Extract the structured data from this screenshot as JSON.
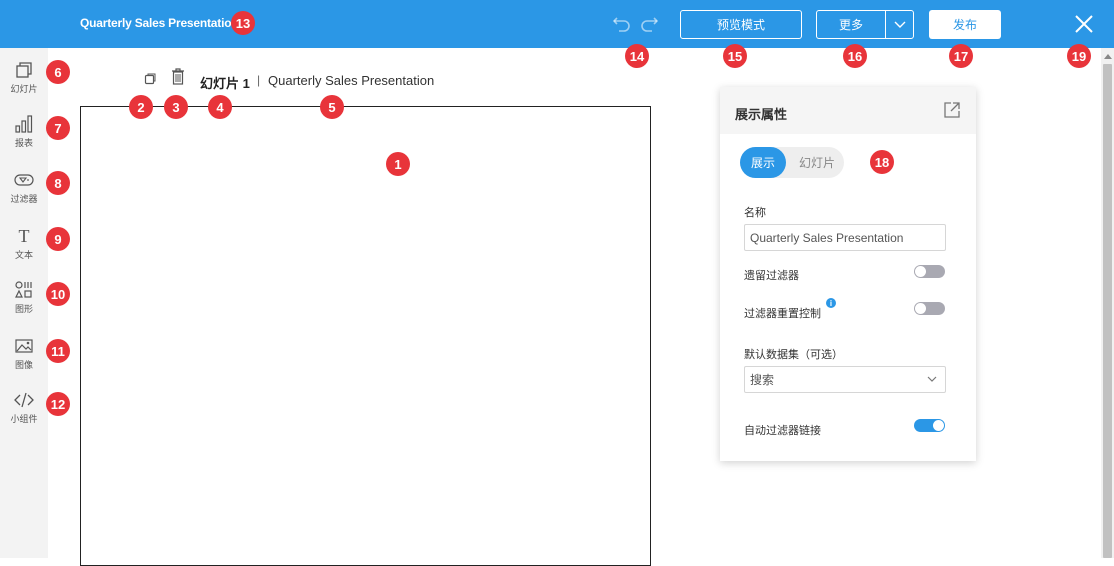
{
  "header": {
    "app_title": "Quarterly Sales Presentation",
    "preview_label": "预览模式",
    "more_label": "更多",
    "publish_label": "发布"
  },
  "sidebar": {
    "items": [
      {
        "label": "幻灯片",
        "icon": "slides-icon"
      },
      {
        "label": "报表",
        "icon": "bar-chart-icon"
      },
      {
        "label": "过滤器",
        "icon": "filter-icon"
      },
      {
        "label": "文本",
        "icon": "text-icon"
      },
      {
        "label": "图形",
        "icon": "shapes-icon"
      },
      {
        "label": "图像",
        "icon": "image-icon"
      },
      {
        "label": "小组件",
        "icon": "code-widget-icon"
      }
    ]
  },
  "slide_toolbar": {
    "slide_number": "幻灯片 1",
    "separator": "|",
    "slide_name": "Quarterly Sales Presentation"
  },
  "properties_panel": {
    "title": "展示属性",
    "tabs": [
      "展示",
      "幻灯片"
    ],
    "active_tab": "展示",
    "name_label": "名称",
    "name_value": "Quarterly Sales Presentation",
    "retain_filters_label": "遗留过滤器",
    "retain_filters_on": false,
    "filter_reset_label": "过滤器重置控制",
    "filter_reset_on": false,
    "info_glyph": "i",
    "default_dataset_label": "默认数据集（可选）",
    "dataset_placeholder": "搜索",
    "auto_filter_link_label": "自动过滤器链接",
    "auto_filter_link_on": true
  },
  "annotations": [
    "1",
    "2",
    "3",
    "4",
    "5",
    "6",
    "7",
    "8",
    "9",
    "10",
    "11",
    "12",
    "13",
    "14",
    "15",
    "16",
    "17",
    "18",
    "19"
  ],
  "colors": {
    "accent": "#2b97e6",
    "badge": "#e8343a",
    "sidebar_bg": "#f3f3f3"
  }
}
